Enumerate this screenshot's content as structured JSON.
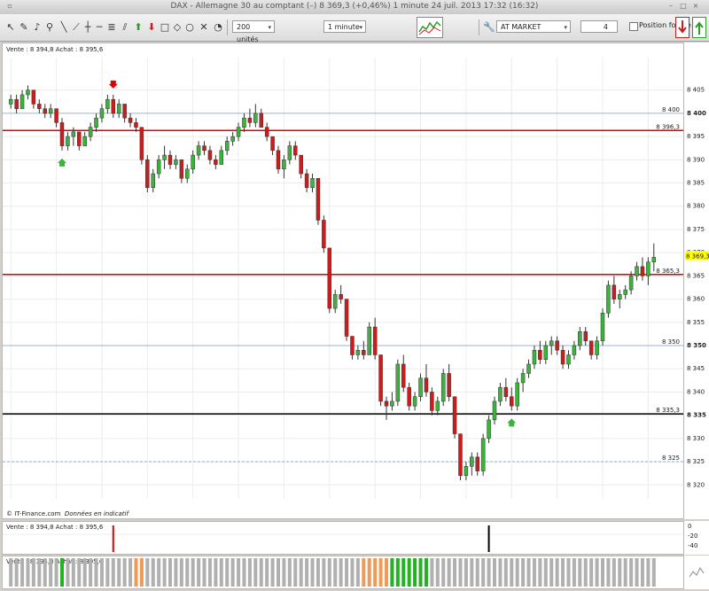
{
  "window": {
    "title": "DAX - Allemagne 30 au comptant (–)    8 369,3 (+0,46%)    1 minute  24 juil. 2013 17:32 (16:32)"
  },
  "toolbar": {
    "units_select": "200 unités",
    "interval_select": "1 minute",
    "order_type_select": "AT MARKET",
    "quantity_value": "4",
    "forced_position_label": "Position forcée"
  },
  "colors": {
    "bull": "#3cb33c",
    "bear": "#c81e1e",
    "hline_red": "#e00000",
    "hline_blue": "#7aa0d8",
    "hline_black": "#000000",
    "price_tag": "#ffff00"
  },
  "price_pane": {
    "label": "Vente : 8 394,8 Achat : 8 395,6",
    "credit": "© IT-Finance.com",
    "credit_note": "Données en indicatif"
  },
  "sub_pane1": {
    "label": "Vente : 8 394,8 Achat : 8 395,6",
    "ticks": [
      "0",
      "-20",
      "-40"
    ]
  },
  "sub_pane2": {
    "label": "Vente : 8 394,8 Achat : 8 395,6"
  },
  "chart_data": {
    "type": "candlestick",
    "ylim": [
      8317,
      8412
    ],
    "y_ticks": [
      8405,
      8400,
      8395,
      8390,
      8385,
      8380,
      8375,
      8370,
      8365,
      8360,
      8355,
      8350,
      8345,
      8340,
      8335,
      8330,
      8325,
      8320
    ],
    "bold_ticks": [
      8400,
      8350,
      8335
    ],
    "last_price": "8 369,3",
    "horizontal_lines": [
      {
        "value": 8400,
        "label": "8 400",
        "color": "blue"
      },
      {
        "value": 8396.3,
        "label": "8 396,3",
        "color": "red"
      },
      {
        "value": 8365.3,
        "label": "8 365,3",
        "color": "red"
      },
      {
        "value": 8350,
        "label": "8 350",
        "color": "blue"
      },
      {
        "value": 8335.3,
        "label": "8 335,3",
        "color": "black"
      },
      {
        "value": 8325,
        "label": "8 325",
        "color": "blue"
      }
    ],
    "signals": [
      {
        "index": 18,
        "dir": "down",
        "color": "red"
      },
      {
        "index": 9,
        "dir": "up",
        "color": "green"
      },
      {
        "index": 88,
        "dir": "up",
        "color": "green"
      }
    ],
    "candles": [
      [
        8402,
        8404,
        8401,
        8403
      ],
      [
        8403,
        8404,
        8400,
        8401
      ],
      [
        8401,
        8405,
        8401,
        8404
      ],
      [
        8404,
        8406,
        8403,
        8405
      ],
      [
        8405,
        8405,
        8401,
        8402
      ],
      [
        8402,
        8403,
        8400,
        8401
      ],
      [
        8401,
        8402,
        8399,
        8400
      ],
      [
        8400,
        8402,
        8399,
        8401
      ],
      [
        8401,
        8401,
        8397,
        8398
      ],
      [
        8398,
        8399,
        8392,
        8393
      ],
      [
        8393,
        8396,
        8392,
        8395
      ],
      [
        8395,
        8397,
        8393,
        8396
      ],
      [
        8396,
        8396,
        8392,
        8393
      ],
      [
        8393,
        8396,
        8393,
        8395
      ],
      [
        8395,
        8398,
        8394,
        8397
      ],
      [
        8397,
        8400,
        8396,
        8399
      ],
      [
        8399,
        8402,
        8398,
        8401
      ],
      [
        8401,
        8404,
        8400,
        8403
      ],
      [
        8403,
        8404,
        8399,
        8400
      ],
      [
        8400,
        8403,
        8399,
        8402
      ],
      [
        8402,
        8402,
        8398,
        8399
      ],
      [
        8399,
        8400,
        8397,
        8398
      ],
      [
        8398,
        8399,
        8396,
        8397
      ],
      [
        8397,
        8397,
        8389,
        8390
      ],
      [
        8390,
        8391,
        8383,
        8384
      ],
      [
        8384,
        8388,
        8383,
        8387
      ],
      [
        8387,
        8391,
        8386,
        8390
      ],
      [
        8390,
        8393,
        8388,
        8391
      ],
      [
        8391,
        8392,
        8388,
        8389
      ],
      [
        8389,
        8391,
        8388,
        8390
      ],
      [
        8390,
        8390,
        8385,
        8386
      ],
      [
        8386,
        8389,
        8385,
        8388
      ],
      [
        8388,
        8392,
        8387,
        8391
      ],
      [
        8391,
        8394,
        8390,
        8393
      ],
      [
        8393,
        8394,
        8391,
        8392
      ],
      [
        8392,
        8393,
        8389,
        8390
      ],
      [
        8390,
        8391,
        8388,
        8389
      ],
      [
        8389,
        8393,
        8389,
        8392
      ],
      [
        8392,
        8395,
        8391,
        8394
      ],
      [
        8394,
        8396,
        8393,
        8395
      ],
      [
        8395,
        8398,
        8394,
        8397
      ],
      [
        8397,
        8400,
        8396,
        8399
      ],
      [
        8399,
        8401,
        8397,
        8398
      ],
      [
        8398,
        8402,
        8397,
        8400
      ],
      [
        8400,
        8401,
        8397,
        8397
      ],
      [
        8397,
        8398,
        8394,
        8395
      ],
      [
        8395,
        8395,
        8391,
        8392
      ],
      [
        8392,
        8393,
        8387,
        8388
      ],
      [
        8388,
        8391,
        8386,
        8390
      ],
      [
        8390,
        8394,
        8389,
        8393
      ],
      [
        8393,
        8394,
        8390,
        8391
      ],
      [
        8391,
        8391,
        8386,
        8387
      ],
      [
        8387,
        8388,
        8383,
        8384
      ],
      [
        8384,
        8387,
        8383,
        8386
      ],
      [
        8386,
        8386,
        8376,
        8377
      ],
      [
        8377,
        8378,
        8370,
        8371
      ],
      [
        8371,
        8371,
        8357,
        8358
      ],
      [
        8358,
        8362,
        8357,
        8361
      ],
      [
        8361,
        8363,
        8359,
        8360
      ],
      [
        8360,
        8360,
        8351,
        8352
      ],
      [
        8352,
        8352,
        8347,
        8348
      ],
      [
        8348,
        8350,
        8347,
        8349
      ],
      [
        8349,
        8351,
        8347,
        8348
      ],
      [
        8348,
        8355,
        8348,
        8354
      ],
      [
        8354,
        8356,
        8347,
        8348
      ],
      [
        8348,
        8348,
        8337,
        8338
      ],
      [
        8338,
        8339,
        8334,
        8337
      ],
      [
        8337,
        8340,
        8336,
        8338
      ],
      [
        8338,
        8347,
        8337,
        8346
      ],
      [
        8346,
        8348,
        8340,
        8341
      ],
      [
        8341,
        8342,
        8336,
        8337
      ],
      [
        8337,
        8340,
        8336,
        8339
      ],
      [
        8339,
        8344,
        8338,
        8343
      ],
      [
        8343,
        8346,
        8339,
        8340
      ],
      [
        8340,
        8341,
        8335,
        8336
      ],
      [
        8336,
        8339,
        8335,
        8338
      ],
      [
        8338,
        8345,
        8337,
        8344
      ],
      [
        8344,
        8346,
        8338,
        8339
      ],
      [
        8339,
        8339,
        8330,
        8331
      ],
      [
        8331,
        8331,
        8321,
        8322
      ],
      [
        8322,
        8325,
        8321,
        8324
      ],
      [
        8324,
        8327,
        8322,
        8326
      ],
      [
        8326,
        8327,
        8322,
        8323
      ],
      [
        8323,
        8331,
        8322,
        8330
      ],
      [
        8330,
        8335,
        8329,
        8334
      ],
      [
        8334,
        8339,
        8333,
        8338
      ],
      [
        8338,
        8342,
        8337,
        8341
      ],
      [
        8341,
        8343,
        8338,
        8339
      ],
      [
        8339,
        8341,
        8336,
        8337
      ],
      [
        8337,
        8343,
        8336,
        8342
      ],
      [
        8342,
        8345,
        8340,
        8344
      ],
      [
        8344,
        8347,
        8343,
        8346
      ],
      [
        8346,
        8350,
        8345,
        8349
      ],
      [
        8349,
        8351,
        8346,
        8347
      ],
      [
        8347,
        8351,
        8346,
        8350
      ],
      [
        8350,
        8352,
        8348,
        8351
      ],
      [
        8351,
        8352,
        8348,
        8349
      ],
      [
        8349,
        8350,
        8345,
        8346
      ],
      [
        8346,
        8349,
        8345,
        8348
      ],
      [
        8348,
        8351,
        8347,
        8350
      ],
      [
        8350,
        8354,
        8349,
        8353
      ],
      [
        8353,
        8354,
        8350,
        8351
      ],
      [
        8351,
        8351,
        8347,
        8348
      ],
      [
        8348,
        8352,
        8347,
        8351
      ],
      [
        8351,
        8358,
        8350,
        8357
      ],
      [
        8357,
        8364,
        8356,
        8363
      ],
      [
        8363,
        8365,
        8359,
        8360
      ],
      [
        8360,
        8362,
        8358,
        8361
      ],
      [
        8361,
        8363,
        8360,
        8362
      ],
      [
        8362,
        8366,
        8361,
        8365
      ],
      [
        8365,
        8368,
        8364,
        8367
      ],
      [
        8367,
        8369,
        8364,
        8365
      ],
      [
        8365,
        8369,
        8363,
        8368
      ],
      [
        8368,
        8372,
        8366,
        8369
      ]
    ]
  }
}
